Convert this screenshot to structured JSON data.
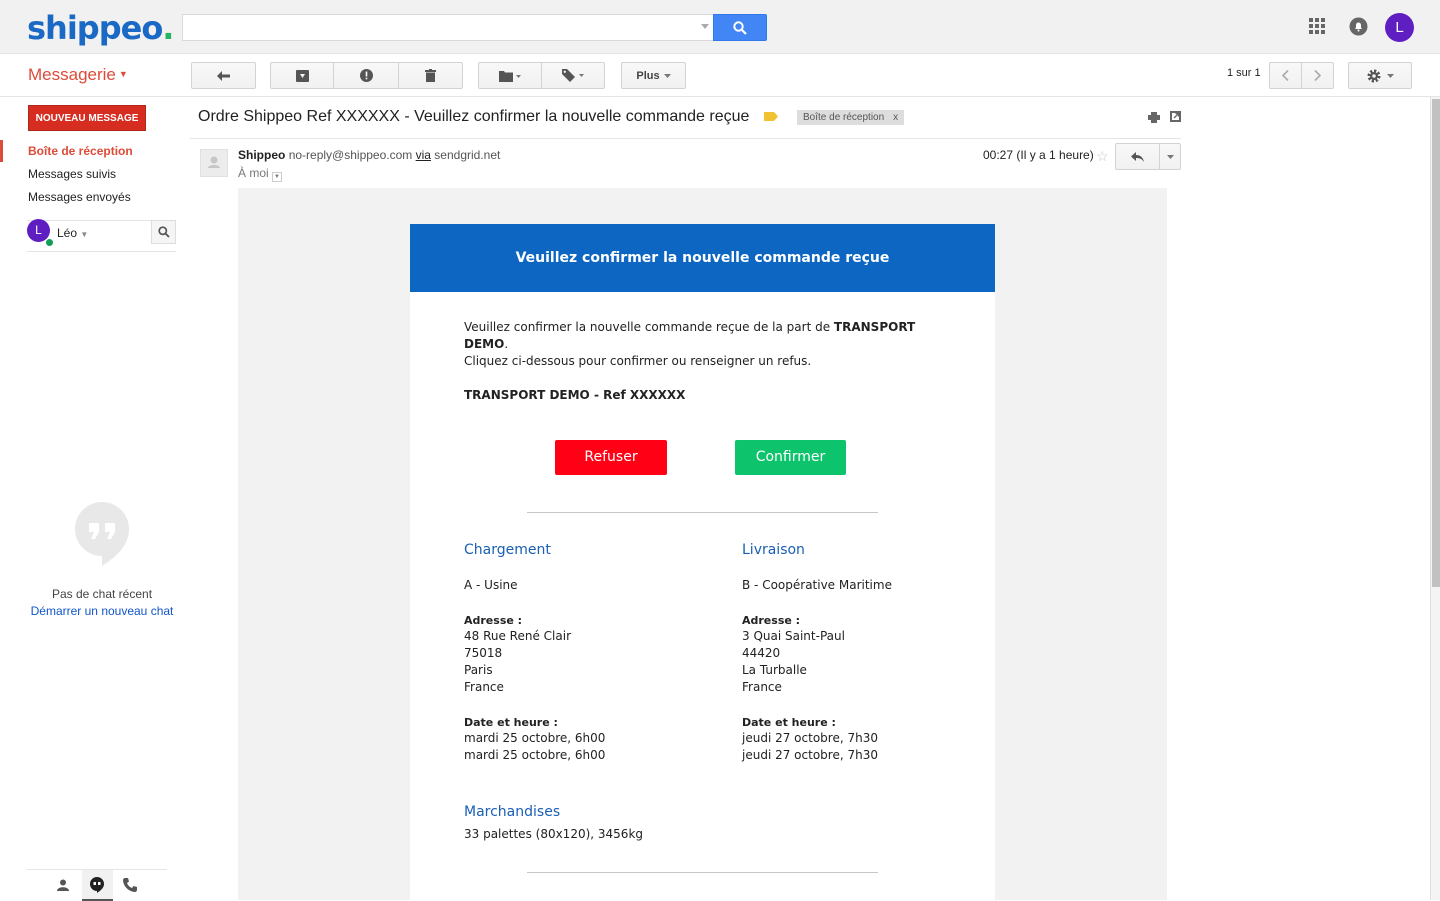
{
  "header": {
    "logo_text": "shippeo",
    "logo_dot": ".",
    "search": {
      "value": "",
      "placeholder": ""
    },
    "user_initial": "L"
  },
  "toolbar": {
    "app_title": "Messagerie",
    "more_label": "Plus",
    "pager_text": "1 sur 1"
  },
  "sidebar": {
    "compose_label": "NOUVEAU MESSAGE",
    "items": [
      {
        "label": "Boîte de réception",
        "active": true
      },
      {
        "label": "Messages suivis",
        "active": false
      },
      {
        "label": "Messages envoyés",
        "active": false
      }
    ],
    "user": {
      "initial": "L",
      "name": "Léo"
    },
    "no_chat_text": "Pas de chat récent",
    "new_chat_link": "Démarrer un nouveau chat"
  },
  "email": {
    "subject": "Ordre Shippeo Ref XXXXXX - Veuillez confirmer la nouvelle commande reçue",
    "inbox_tag": "Boîte de réception",
    "inbox_tag_close": "x",
    "sender_name": "Shippeo",
    "sender_email": "no-reply@shippeo.com",
    "via_label": "via",
    "via_domain": "sendgrid.net",
    "to_label": "À moi",
    "time": "00:27 (Il y a 1 heure)"
  },
  "body": {
    "banner": "Veuillez confirmer la nouvelle commande reçue",
    "intro_prefix": "Veuillez confirmer la nouvelle commande reçue de la part de ",
    "intro_company": "TRANSPORT DEMO",
    "intro_suffix": ".",
    "intro_line2": "Cliquez ci-dessous pour confirmer ou renseigner un refus.",
    "ref_line": "TRANSPORT DEMO - Ref XXXXXX",
    "refuse_label": "Refuser",
    "confirm_label": "Confirmer",
    "pickup": {
      "title": "Chargement",
      "site": "A - Usine",
      "address_label": "Adresse :",
      "address_lines": [
        "48 Rue René Clair",
        "75018",
        "Paris",
        "France"
      ],
      "date_label": "Date et heure :",
      "date_lines": [
        "mardi 25 octobre, 6h00",
        "mardi 25 octobre, 6h00"
      ]
    },
    "delivery": {
      "title": "Livraison",
      "site": "B - Coopérative Maritime",
      "address_label": "Adresse :",
      "address_lines": [
        "3 Quai Saint-Paul",
        "44420",
        "La Turballe",
        "France"
      ],
      "date_label": "Date et heure :",
      "date_lines": [
        "jeudi 27 octobre, 7h30",
        "jeudi 27 octobre, 7h30"
      ]
    },
    "goods": {
      "title": "Marchandises",
      "value": "33 palettes (80x120), 3456kg"
    }
  },
  "colors": {
    "brand_blue": "#1a69c4",
    "accent_red": "#dd4b39",
    "banner_blue": "#0d66c2",
    "refuse_red": "#ff0015",
    "confirm_green": "#0dc36b"
  }
}
